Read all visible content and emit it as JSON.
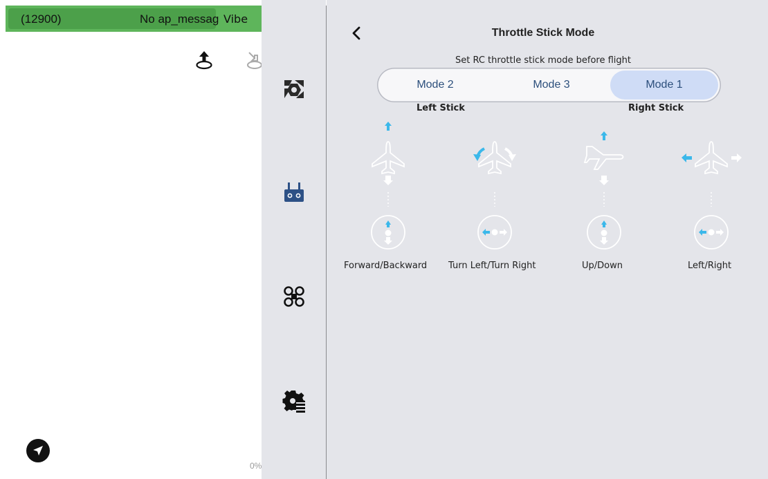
{
  "status_bar": {
    "id_text": "(12900)",
    "message": "No ap_message",
    "vibe": "Vibe"
  },
  "footer": {
    "percent": "0%"
  },
  "colors": {
    "accent": "#3bb8ea",
    "status_green": "#5eb55b",
    "segment_active": "#cfdcf6",
    "nav_icon_blue": "#2d5186"
  },
  "nav": {
    "items": [
      {
        "icon": "camera-gimbal-icon"
      },
      {
        "icon": "remote-controller-icon"
      },
      {
        "icon": "drone-icon"
      },
      {
        "icon": "settings-gear-icon"
      }
    ]
  },
  "header": {
    "title": "Throttle Stick Mode",
    "subtitle": "Set RC throttle stick mode before flight"
  },
  "modes": {
    "options": [
      "Mode 2",
      "Mode 3",
      "Mode 1"
    ],
    "selected": "Mode 1"
  },
  "sticks": {
    "left_label": "Left Stick",
    "right_label": "Right Stick"
  },
  "controls": [
    {
      "caption": "Forward/Backward"
    },
    {
      "caption": "Turn Left/Turn Right"
    },
    {
      "caption": "Up/Down"
    },
    {
      "caption": "Left/Right"
    }
  ]
}
